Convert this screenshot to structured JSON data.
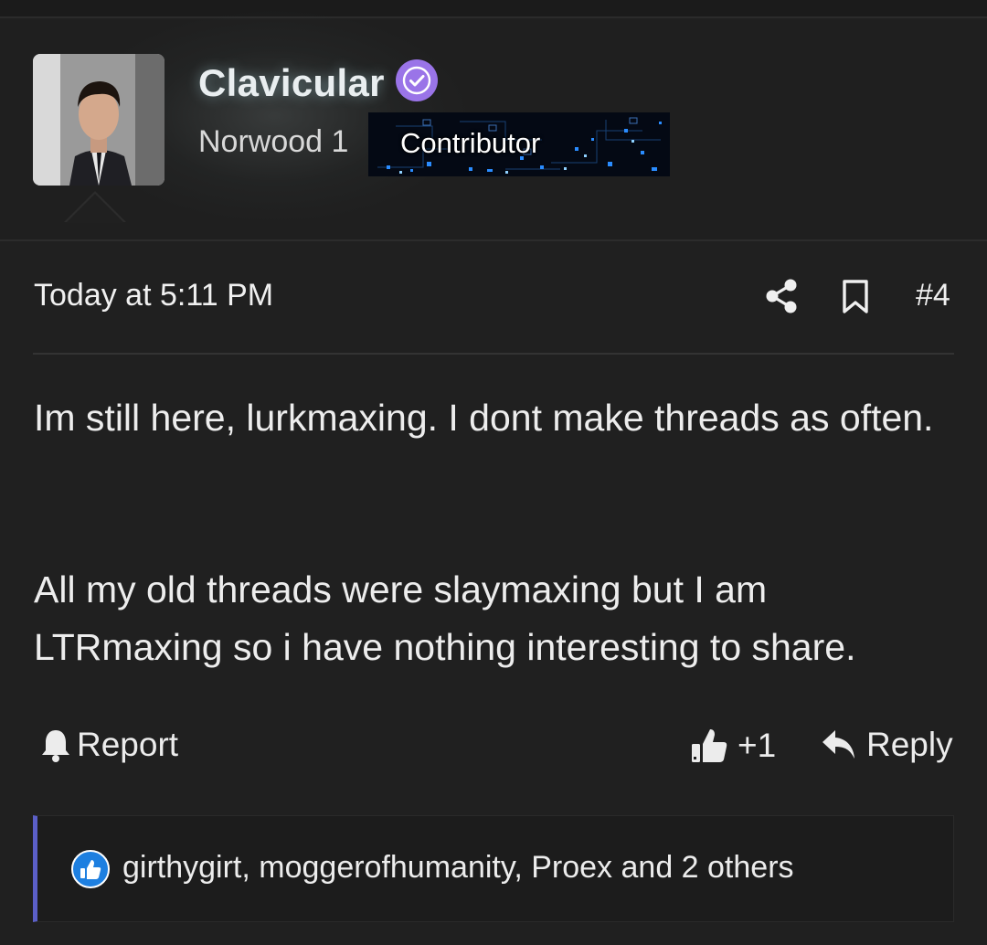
{
  "user": {
    "name": "Clavicular",
    "title": "Norwood 1",
    "banner": "Contributor",
    "verified": true
  },
  "post": {
    "timestamp": "Today at 5:11 PM",
    "number": "#4",
    "paragraphs": [
      "Im still here, lurkmaxing. I dont make threads as often.",
      "All my old threads were slaymaxing but I am LTRmaxing so i have nothing interesting to share."
    ]
  },
  "actions": {
    "report": "Report",
    "like_count": "+1",
    "reply": "Reply"
  },
  "reactions": {
    "text": "girthygirt, moggerofhumanity, Proex and 2 others"
  },
  "colors": {
    "background": "#202020",
    "verified_badge": "#9a74e8",
    "reaction_bar": "#5b5fc7",
    "like_icon": "#1d7fe0"
  },
  "icons": [
    "verified-icon",
    "share-icon",
    "bookmark-icon",
    "bell-icon",
    "thumbs-up-icon",
    "reply-icon",
    "like-reaction-icon"
  ]
}
